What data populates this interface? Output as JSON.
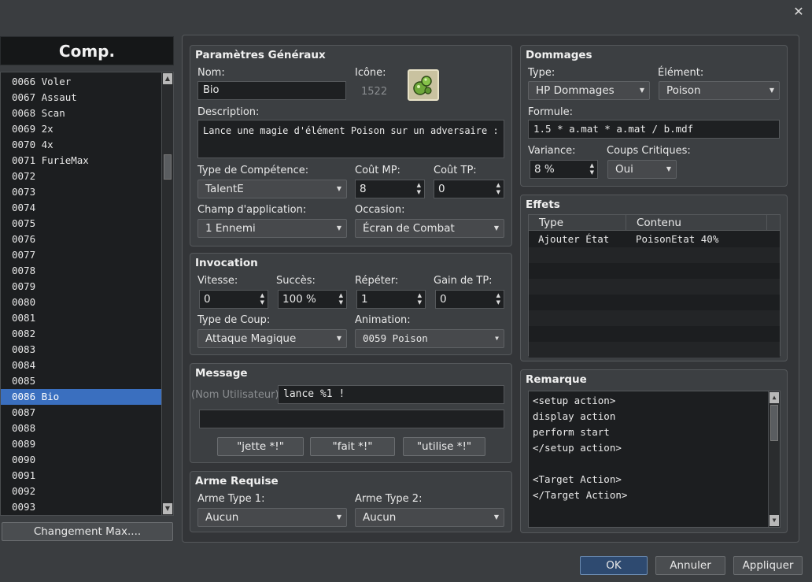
{
  "window": {
    "close_glyph": "✕"
  },
  "list": {
    "header": "Comp.",
    "items": [
      "0066 Voler",
      "0067 Assaut",
      "0068 Scan",
      "0069 2x",
      "0070 4x",
      "0071 FurieMax",
      "0072",
      "0073",
      "0074",
      "0075",
      "0076",
      "0077",
      "0078",
      "0079",
      "0080",
      "0081",
      "0082",
      "0083",
      "0084",
      "0085",
      "0086 Bio",
      "0087",
      "0088",
      "0089",
      "0090",
      "0091",
      "0092",
      "0093"
    ],
    "selected_index": 20,
    "change_max_label": "Changement Max...."
  },
  "general": {
    "title": "Paramètres Généraux",
    "name_label": "Nom:",
    "name_value": "Bio",
    "icon_label": "Icône:",
    "icon_index": "1522",
    "desc_label": "Description:",
    "desc_value": "Lance une magie d'élément Poison sur un adversaire : Peu",
    "skill_type_label": "Type de Compétence:",
    "skill_type_value": "TalentE",
    "mp_label": "Coût MP:",
    "mp_value": "8",
    "tp_label": "Coût TP:",
    "tp_value": "0",
    "scope_label": "Champ d'application:",
    "scope_value": "1 Ennemi",
    "occasion_label": "Occasion:",
    "occasion_value": "Écran de Combat"
  },
  "invocation": {
    "title": "Invocation",
    "speed_label": "Vitesse:",
    "speed_value": "0",
    "success_label": "Succès:",
    "success_value": "100 %",
    "repeat_label": "Répéter:",
    "repeat_value": "1",
    "tp_gain_label": "Gain de TP:",
    "tp_gain_value": "0",
    "hit_type_label": "Type de Coup:",
    "hit_type_value": "Attaque Magique",
    "animation_label": "Animation:",
    "animation_value": "0059 Poison"
  },
  "message": {
    "title": "Message",
    "user_label": "(Nom Utilisateur)",
    "line1": "lance %1 !",
    "line2": "",
    "btn1": "\"jette *!\"",
    "btn2": "\"fait *!\"",
    "btn3": "\"utilise *!\""
  },
  "weapon": {
    "title": "Arme Requise",
    "type1_label": "Arme Type 1:",
    "type1_value": "Aucun",
    "type2_label": "Arme Type 2:",
    "type2_value": "Aucun"
  },
  "damage": {
    "title": "Dommages",
    "type_label": "Type:",
    "type_value": "HP Dommages",
    "element_label": "Élément:",
    "element_value": "Poison",
    "formula_label": "Formule:",
    "formula_value": "1.5 * a.mat * a.mat / b.mdf",
    "variance_label": "Variance:",
    "variance_value": "8 %",
    "crit_label": "Coups Critiques:",
    "crit_value": "Oui"
  },
  "effects": {
    "title": "Effets",
    "col_type": "Type",
    "col_content": "Contenu",
    "rows": [
      {
        "type": "Ajouter État",
        "content": "PoisonEtat 40%"
      }
    ]
  },
  "note": {
    "title": "Remarque",
    "lines": [
      "<setup action>",
      "display action",
      "perform start",
      "</setup action>",
      "",
      "<Target Action>",
      "</Target Action>"
    ]
  },
  "footer": {
    "ok": "OK",
    "cancel": "Annuler",
    "apply": "Appliquer"
  },
  "colors": {
    "selection": "#3a6fbf",
    "background": "#3a3d40"
  }
}
